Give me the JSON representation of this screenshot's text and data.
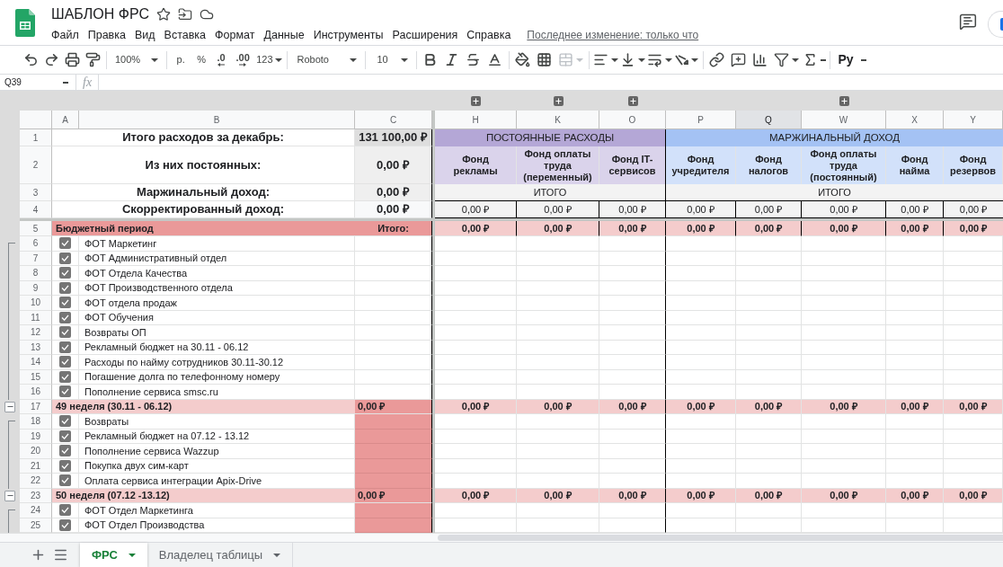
{
  "document": {
    "title": "ШАБЛОН ФРС",
    "last_edit": "Последнее изменение: только что"
  },
  "menu": [
    "Файл",
    "Правка",
    "Вид",
    "Вставка",
    "Формат",
    "Данные",
    "Инструменты",
    "Расширения",
    "Справка"
  ],
  "toolbar": {
    "zoom": "100%",
    "currency": "р.",
    "percent": "%",
    "decimal_decrease": ".0",
    "decimal_increase": ".00",
    "number_format": "123",
    "font": "Roboto",
    "font_size": "10",
    "addon": "Ру"
  },
  "formula_bar": {
    "cell_ref": "Q39",
    "fx": "fx"
  },
  "columns": [
    {
      "letter": "A",
      "selected": false,
      "collapsed_group": false
    },
    {
      "letter": "B",
      "selected": false,
      "collapsed_group": false
    },
    {
      "letter": "C",
      "selected": false,
      "collapsed_group": false
    },
    {
      "letter": "H",
      "selected": false,
      "collapsed_group": true
    },
    {
      "letter": "K",
      "selected": false,
      "collapsed_group": true
    },
    {
      "letter": "O",
      "selected": false,
      "collapsed_group": true
    },
    {
      "letter": "P",
      "selected": false,
      "collapsed_group": false
    },
    {
      "letter": "Q",
      "selected": true,
      "collapsed_group": false
    },
    {
      "letter": "W",
      "selected": false,
      "collapsed_group": true
    },
    {
      "letter": "X",
      "selected": false,
      "collapsed_group": false
    },
    {
      "letter": "Y",
      "selected": false,
      "collapsed_group": false
    }
  ],
  "summary": [
    {
      "number": "1",
      "label": "Итого расходов за декабрь:",
      "value": "131 100,00 ₽"
    },
    {
      "number": "2",
      "label": "Из них постоянных:",
      "value": "0,00 ₽"
    },
    {
      "number": "3",
      "label": "Маржинальный доход:",
      "value": "0,00 ₽"
    },
    {
      "number": "4",
      "label": "Скорректированный доход:",
      "value": "0,00 ₽"
    }
  ],
  "fund_groups": [
    {
      "title": "ПОСТОЯННЫЕ РАСХОДЫ",
      "color": "#b4a7d6",
      "total_label": "ИТОГО",
      "funds": [
        {
          "name": "Фонд рекламы",
          "total": "0,00 ₽"
        },
        {
          "name": "Фонд оплаты труда (переменный)",
          "total": "0,00 ₽"
        },
        {
          "name": "Фонд IT-сервисов",
          "total": "0,00 ₽"
        }
      ]
    },
    {
      "title": "МАРЖИНАЛЬНЫЙ ДОХОД",
      "color": "#a4c2f4",
      "total_label": "ИТОГО",
      "funds": [
        {
          "name": "Фонд учредителя",
          "total": "0,00 ₽"
        },
        {
          "name": "Фонд налогов",
          "total": "0,00 ₽"
        },
        {
          "name": "Фонд оплаты труда (постоянный)",
          "total": "0,00 ₽"
        },
        {
          "name": "Фонд найма",
          "total": "0,00 ₽"
        },
        {
          "name": "Фонд резервов",
          "total": "0,00 ₽"
        }
      ]
    }
  ],
  "budget": {
    "number": "5",
    "label": "Бюджетный период",
    "total_label": "Итого:",
    "values": [
      "0,00 ₽",
      "0,00 ₽",
      "0,00 ₽",
      "0,00 ₽",
      "0,00 ₽",
      "0,00 ₽",
      "0,00 ₽",
      "0,00 ₽"
    ],
    "groups": [
      {
        "highlighted": false,
        "items": [
          {
            "number": "6",
            "checked": true,
            "label": "ФОТ Маркетинг"
          },
          {
            "number": "7",
            "checked": true,
            "label": "ФОТ Административный отдел"
          },
          {
            "number": "8",
            "checked": true,
            "label": "ФОТ Отдела Качества"
          },
          {
            "number": "9",
            "checked": true,
            "label": "ФОТ Производственного отдела"
          },
          {
            "number": "10",
            "checked": true,
            "label": "ФОТ отдела продаж"
          },
          {
            "number": "11",
            "checked": true,
            "label": "ФОТ Обучения"
          },
          {
            "number": "12",
            "checked": true,
            "label": "Возвраты ОП"
          },
          {
            "number": "13",
            "checked": true,
            "label": "Рекламный бюджет на 30.11 - 06.12"
          },
          {
            "number": "14",
            "checked": true,
            "label": "Расходы по найму сотрудников 30.11-30.12"
          },
          {
            "number": "15",
            "checked": true,
            "label": "Погашение долга по телефонному номеру"
          },
          {
            "number": "16",
            "checked": true,
            "label": "Пополнение сервиса smsc.ru"
          }
        ],
        "week": {
          "number": "17",
          "label": "49 неделя (30.11 - 06.12)",
          "total": "0,00 ₽",
          "expanded": true,
          "values": [
            "0,00 ₽",
            "0,00 ₽",
            "0,00 ₽",
            "0,00 ₽",
            "0,00 ₽",
            "0,00 ₽",
            "0,00 ₽",
            "0,00 ₽"
          ]
        }
      },
      {
        "highlighted": true,
        "items": [
          {
            "number": "18",
            "checked": true,
            "label": "Возвраты"
          },
          {
            "number": "19",
            "checked": true,
            "label": "Рекламный бюджет на 07.12 - 13.12"
          },
          {
            "number": "20",
            "checked": true,
            "label": "Пополнение сервиса Wazzup"
          },
          {
            "number": "21",
            "checked": true,
            "label": "Покупка двух сим-карт"
          },
          {
            "number": "22",
            "checked": true,
            "label": "Оплата сервиса интеграции Apix-Drive"
          }
        ],
        "week": {
          "number": "23",
          "label": "50 неделя (07.12 -13.12)",
          "total": "0,00 ₽",
          "expanded": true,
          "values": [
            "0,00 ₽",
            "0,00 ₽",
            "0,00 ₽",
            "0,00 ₽",
            "0,00 ₽",
            "0,00 ₽",
            "0,00 ₽",
            "0,00 ₽"
          ]
        }
      },
      {
        "highlighted": true,
        "items": [
          {
            "number": "24",
            "checked": true,
            "label": "ФОТ Отдел Маркетинга"
          },
          {
            "number": "25",
            "checked": true,
            "label": "ФОТ Отдел Производства"
          }
        ]
      }
    ]
  },
  "sheets": [
    {
      "name": "ФРС",
      "selected": true
    },
    {
      "name": "Владелец таблицы",
      "selected": false
    }
  ]
}
